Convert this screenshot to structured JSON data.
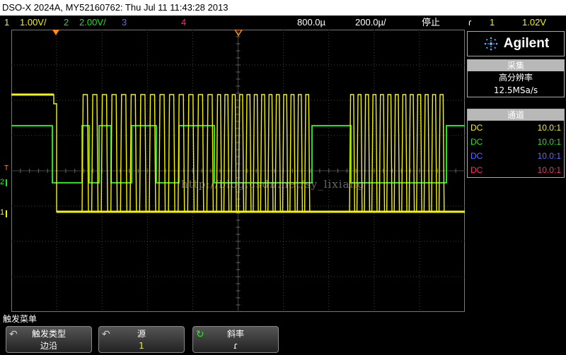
{
  "title": "DSO-X 2024A, MY52160762: Thu Jul 11 11:43:28 2013",
  "status": {
    "ch1_num": "1",
    "ch1_scale": "1.00V/",
    "ch2_num": "2",
    "ch2_scale": "2.00V/",
    "ch3_num": "3",
    "ch4_num": "4",
    "timebase": "800.0µ",
    "delay": "200.0µ/",
    "run_state": "停止",
    "trig_slope": "ɾ",
    "trig_source": "1",
    "trig_level": "1.02V"
  },
  "markers": {
    "trig_T": "T",
    "ch2": "2",
    "ch1": "1"
  },
  "watermark": "http://blog.csdn.net/sy_lixiang",
  "brand": "Agilent",
  "acquisition": {
    "header": "采集",
    "mode": "高分辨率",
    "rate": "12.5MSa/s"
  },
  "channels": {
    "header": "通道",
    "rows": [
      {
        "coupling": "DC",
        "probe": "10.0:1",
        "color": "#f5f500"
      },
      {
        "coupling": "DC",
        "probe": "10.0:1",
        "color": "#22e022"
      },
      {
        "coupling": "DC",
        "probe": "10.0:1",
        "color": "#5b6bff"
      },
      {
        "coupling": "DC",
        "probe": "10.0:1",
        "color": "#ff2a6a"
      }
    ]
  },
  "menu": {
    "title": "触发菜单"
  },
  "softkeys": [
    {
      "label": "触发类型",
      "value": "边沿"
    },
    {
      "label": "源",
      "value": "1"
    },
    {
      "label": "斜率",
      "value": "ɾ"
    }
  ],
  "colors": {
    "ch1": "#f5f500",
    "ch2": "#22e022",
    "ch3": "#5b6bff",
    "ch4": "#ff2a6a",
    "accent": "#ff8c1a"
  }
}
